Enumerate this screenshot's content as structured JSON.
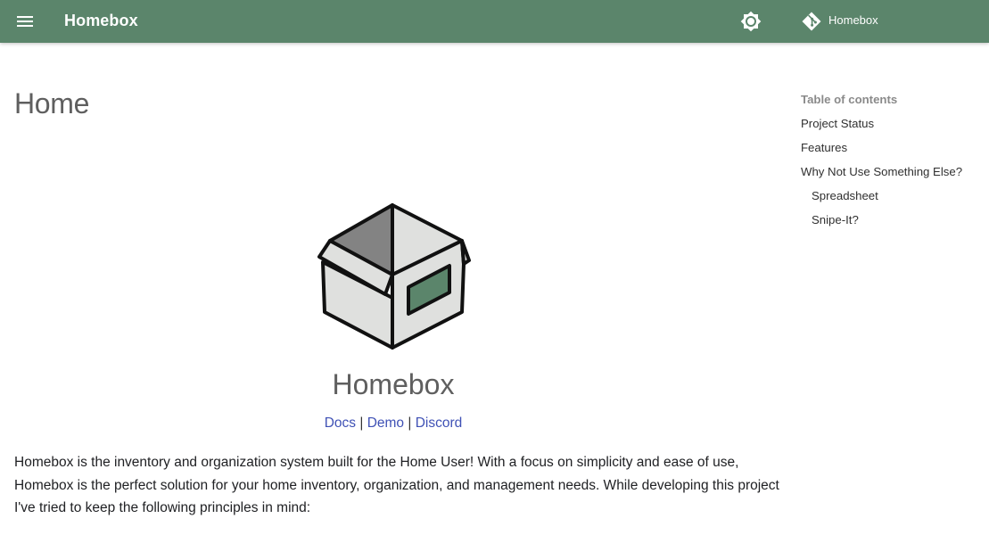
{
  "header": {
    "site_title": "Homebox",
    "repo_name": "Homebox",
    "icons": [
      "menu-icon",
      "brightness-icon",
      "git-icon"
    ],
    "color": "#5b856b"
  },
  "page": {
    "title": "Home"
  },
  "hero": {
    "logo_icon": "box-logo-icon",
    "project_name": "Homebox",
    "links": {
      "docs": "Docs",
      "demo": "Demo",
      "discord": "Discord",
      "separator": "|"
    }
  },
  "intro": {
    "text": "Homebox is the inventory and organization system built for the Home User! With a focus on simplicity and ease of use, Homebox is the perfect solution for your home inventory, organization, and management needs. While developing this project I've tried to keep the following principles in mind:"
  },
  "toc": {
    "title": "Table of contents",
    "items": [
      {
        "label": "Project Status"
      },
      {
        "label": "Features"
      },
      {
        "label": "Why Not Use Something Else?"
      },
      {
        "label": "Spreadsheet"
      },
      {
        "label": "Snipe-It?"
      }
    ]
  },
  "colors": {
    "link": "#3f51b5",
    "logo_label": "#5b856b"
  }
}
